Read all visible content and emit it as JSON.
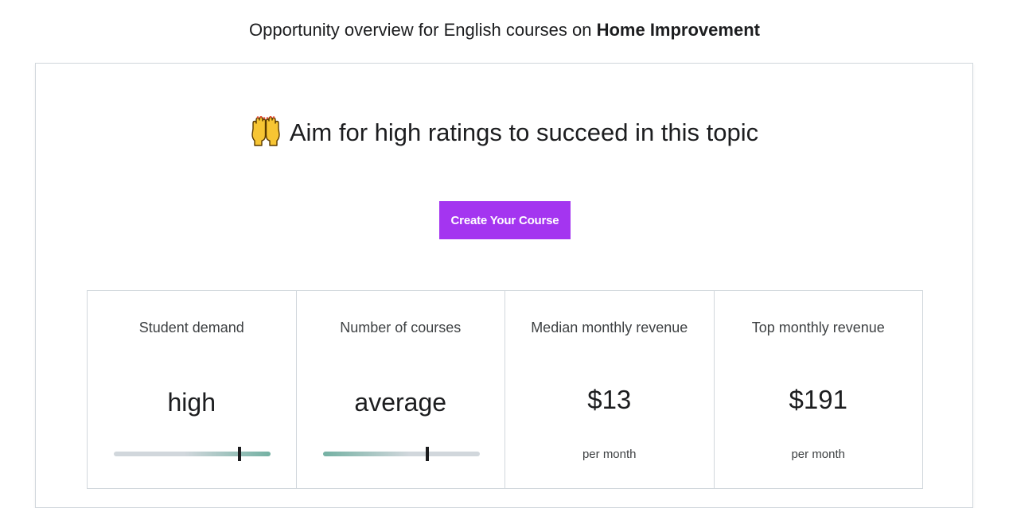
{
  "header": {
    "prefix": "Opportunity overview for English courses on ",
    "topic": "Home Improvement"
  },
  "card": {
    "headline_icon": "raising-hands-emoji",
    "headline": "Aim for high ratings to succeed in this topic",
    "cta_label": "Create Your Course",
    "accent_color": "#a435f0"
  },
  "stats": [
    {
      "label": "Student demand",
      "value": "high",
      "level": 0.8
    },
    {
      "label": "Number of courses",
      "value": "average",
      "level": 0.67
    },
    {
      "label": "Median monthly revenue",
      "value": "$13",
      "sub": "per month"
    },
    {
      "label": "Top monthly revenue",
      "value": "$191",
      "sub": "per month"
    }
  ],
  "colors": {
    "meter_fill": "#74b1a3",
    "meter_track": "#d1d7dc",
    "border": "#d1d7dc"
  }
}
